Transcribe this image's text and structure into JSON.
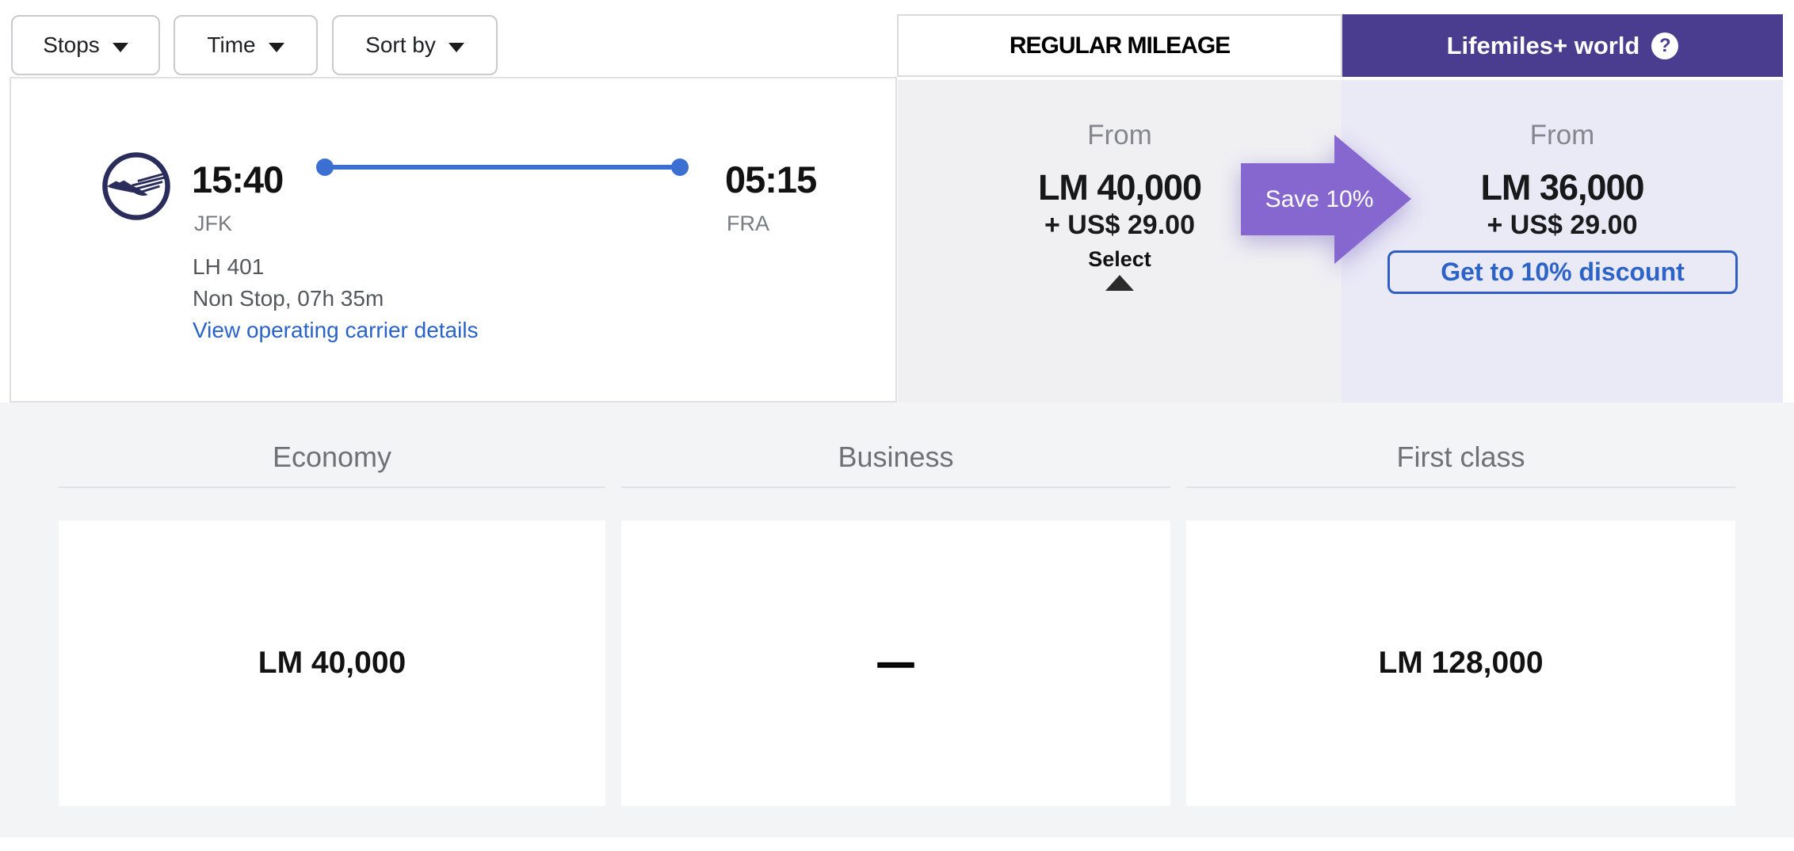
{
  "filters": [
    {
      "label": "Stops"
    },
    {
      "label": "Time"
    },
    {
      "label": "Sort by"
    }
  ],
  "tabs": {
    "regular": {
      "label": "REGULAR MILEAGE"
    },
    "plus": {
      "label": "Lifemiles+ world",
      "help": "?"
    }
  },
  "flight": {
    "logo_icon": "lufthansa-crane",
    "departure": {
      "time": "15:40",
      "airport": "JFK"
    },
    "arrival": {
      "time": "05:15",
      "airport": "FRA"
    },
    "flight_number": "LH 401",
    "stops_duration": "Non Stop, 07h 35m",
    "operating_carrier_link": "View operating carrier details"
  },
  "regular_mileage": {
    "from_label": "From",
    "miles": "LM 40,000",
    "taxes": "+ US$ 29.00",
    "select_label": "Select"
  },
  "promo_arrow": {
    "label": "Save 10%"
  },
  "lifemiles_plus": {
    "from_label": "From",
    "miles": "LM 36,000",
    "taxes": "+ US$ 29.00",
    "cta_label": "Get to 10% discount"
  },
  "cabins": [
    {
      "name": "Economy",
      "price": "LM 40,000"
    },
    {
      "name": "Business",
      "price": "—"
    },
    {
      "name": "First class",
      "price": "LM 128,000"
    }
  ],
  "colors": {
    "brand_purple": "#4A3D90",
    "promo_purple": "#8667D0",
    "lavender_bg": "#EAE9F6",
    "column_gray": "#F0F0F3",
    "section_bg": "#F3F4F6",
    "link_blue": "#2A63C8",
    "cta_blue": "#2E5FC4",
    "route_blue": "#3B6FD1",
    "logo_navy": "#2A2D5C"
  }
}
